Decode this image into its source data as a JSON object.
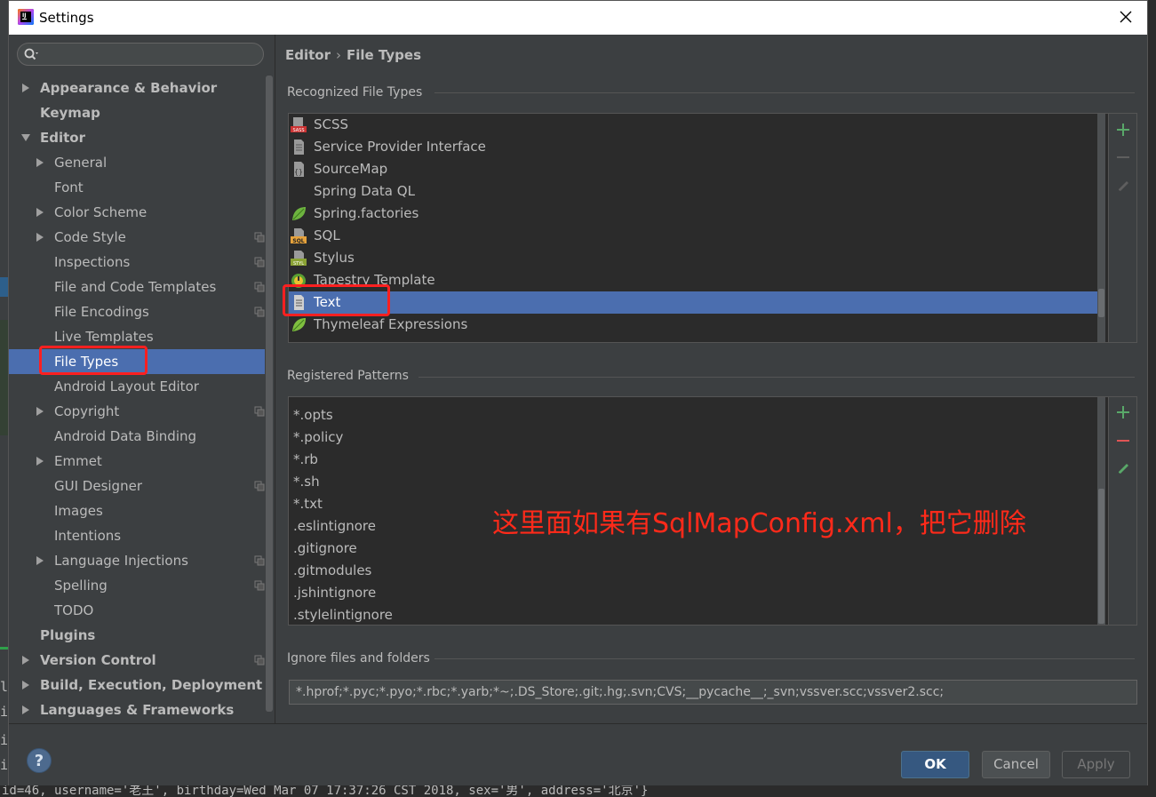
{
  "window": {
    "title": "Settings"
  },
  "search": {
    "placeholder": ""
  },
  "tree": [
    {
      "label": "Appearance & Behavior",
      "level": 0,
      "arrow": "right",
      "bold": true,
      "copy": false,
      "selected": false
    },
    {
      "label": "Keymap",
      "level": 0,
      "arrow": "none",
      "bold": true,
      "copy": false,
      "selected": false
    },
    {
      "label": "Editor",
      "level": 0,
      "arrow": "down",
      "bold": true,
      "copy": false,
      "selected": false
    },
    {
      "label": "General",
      "level": 1,
      "arrow": "right",
      "bold": false,
      "copy": false,
      "selected": false
    },
    {
      "label": "Font",
      "level": 1,
      "arrow": "none",
      "bold": false,
      "copy": false,
      "selected": false
    },
    {
      "label": "Color Scheme",
      "level": 1,
      "arrow": "right",
      "bold": false,
      "copy": false,
      "selected": false
    },
    {
      "label": "Code Style",
      "level": 1,
      "arrow": "right",
      "bold": false,
      "copy": true,
      "selected": false
    },
    {
      "label": "Inspections",
      "level": 1,
      "arrow": "none",
      "bold": false,
      "copy": true,
      "selected": false
    },
    {
      "label": "File and Code Templates",
      "level": 1,
      "arrow": "none",
      "bold": false,
      "copy": true,
      "selected": false
    },
    {
      "label": "File Encodings",
      "level": 1,
      "arrow": "none",
      "bold": false,
      "copy": true,
      "selected": false
    },
    {
      "label": "Live Templates",
      "level": 1,
      "arrow": "none",
      "bold": false,
      "copy": false,
      "selected": false
    },
    {
      "label": "File Types",
      "level": 1,
      "arrow": "none",
      "bold": false,
      "copy": false,
      "selected": true
    },
    {
      "label": "Android Layout Editor",
      "level": 1,
      "arrow": "none",
      "bold": false,
      "copy": false,
      "selected": false
    },
    {
      "label": "Copyright",
      "level": 1,
      "arrow": "right",
      "bold": false,
      "copy": true,
      "selected": false
    },
    {
      "label": "Android Data Binding",
      "level": 1,
      "arrow": "none",
      "bold": false,
      "copy": false,
      "selected": false
    },
    {
      "label": "Emmet",
      "level": 1,
      "arrow": "right",
      "bold": false,
      "copy": false,
      "selected": false
    },
    {
      "label": "GUI Designer",
      "level": 1,
      "arrow": "none",
      "bold": false,
      "copy": true,
      "selected": false
    },
    {
      "label": "Images",
      "level": 1,
      "arrow": "none",
      "bold": false,
      "copy": false,
      "selected": false
    },
    {
      "label": "Intentions",
      "level": 1,
      "arrow": "none",
      "bold": false,
      "copy": false,
      "selected": false
    },
    {
      "label": "Language Injections",
      "level": 1,
      "arrow": "right",
      "bold": false,
      "copy": true,
      "selected": false
    },
    {
      "label": "Spelling",
      "level": 1,
      "arrow": "none",
      "bold": false,
      "copy": true,
      "selected": false
    },
    {
      "label": "TODO",
      "level": 1,
      "arrow": "none",
      "bold": false,
      "copy": false,
      "selected": false
    },
    {
      "label": "Plugins",
      "level": 0,
      "arrow": "none",
      "bold": true,
      "copy": false,
      "selected": false
    },
    {
      "label": "Version Control",
      "level": 0,
      "arrow": "right",
      "bold": true,
      "copy": true,
      "selected": false
    },
    {
      "label": "Build, Execution, Deployment",
      "level": 0,
      "arrow": "right",
      "bold": true,
      "copy": false,
      "selected": false
    },
    {
      "label": "Languages & Frameworks",
      "level": 0,
      "arrow": "right",
      "bold": true,
      "copy": false,
      "selected": false
    }
  ],
  "breadcrumb": {
    "parent": "Editor",
    "separator": "›",
    "current": "File Types"
  },
  "recognized": {
    "title": "Recognized File Types",
    "items": [
      {
        "label": "SCSS",
        "icon": "sass-file-icon",
        "selected": false
      },
      {
        "label": "Service Provider Interface",
        "icon": "generic-file-icon",
        "selected": false
      },
      {
        "label": "SourceMap",
        "icon": "sourcemap-file-icon",
        "selected": false
      },
      {
        "label": "Spring Data QL",
        "icon": "none",
        "selected": false
      },
      {
        "label": "Spring.factories",
        "icon": "spring-leaf-icon",
        "selected": false
      },
      {
        "label": "SQL",
        "icon": "sql-file-icon",
        "selected": false
      },
      {
        "label": "Stylus",
        "icon": "stylus-file-icon",
        "selected": false
      },
      {
        "label": "Tapestry Template",
        "icon": "tapestry-icon",
        "selected": false
      },
      {
        "label": "Text",
        "icon": "text-file-icon",
        "selected": true
      },
      {
        "label": "Thymeleaf Expressions",
        "icon": "thymeleaf-leaf-icon",
        "selected": false
      }
    ]
  },
  "patterns": {
    "title": "Registered Patterns",
    "items": [
      "*.opts",
      "*.policy",
      "*.rb",
      "*.sh",
      "*.txt",
      ".eslintignore",
      ".gitignore",
      ".gitmodules",
      ".jshintignore",
      ".stylelintignore"
    ]
  },
  "ignore": {
    "title": "Ignore files and folders",
    "value": "*.hprof;*.pyc;*.pyo;*.rbc;*.yarb;*~;.DS_Store;.git;.hg;.svn;CVS;__pycache__;_svn;vssver.scc;vssver2.scc;"
  },
  "annotation": "这里面如果有SqlMapConfig.xml，把它删除",
  "buttons": {
    "ok": "OK",
    "cancel": "Cancel",
    "apply": "Apply",
    "help": "?"
  },
  "console": "id=46, username='老王', birthday=Wed Mar 07 17:37:26 CST 2018, sex='男', address='北京'}",
  "colors": {
    "accent": "#4b6eaf",
    "annotation": "#ff2a1a",
    "add": "#59a869",
    "remove": "#e05555"
  }
}
